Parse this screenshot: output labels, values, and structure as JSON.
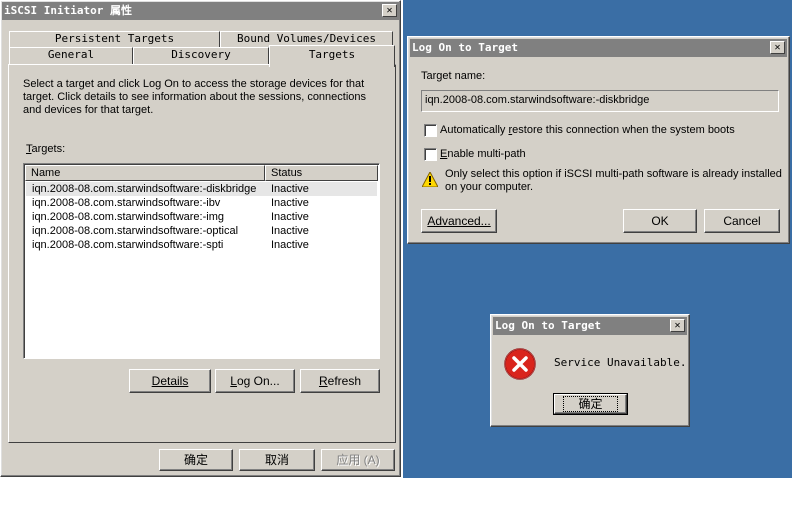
{
  "main_dialog": {
    "title": "iSCSI Initiator 属性",
    "tabs_row1": [
      "Persistent Targets",
      "Bound Volumes/Devices"
    ],
    "tabs_row2": [
      "General",
      "Discovery",
      "Targets"
    ],
    "selected_tab": "Targets",
    "description": "Select a target and click Log On to access the storage devices for that target. Click details to see information about the sessions, connections and devices for that target.",
    "targets_label": "Targets:",
    "columns": [
      "Name",
      "Status"
    ],
    "targets": [
      {
        "name": "iqn.2008-08.com.starwindsoftware:-diskbridge",
        "status": "Inactive"
      },
      {
        "name": "iqn.2008-08.com.starwindsoftware:-ibv",
        "status": "Inactive"
      },
      {
        "name": "iqn.2008-08.com.starwindsoftware:-img",
        "status": "Inactive"
      },
      {
        "name": "iqn.2008-08.com.starwindsoftware:-optical",
        "status": "Inactive"
      },
      {
        "name": "iqn.2008-08.com.starwindsoftware:-spti",
        "status": "Inactive"
      }
    ],
    "details_label": "Details",
    "logon_label": "Log On...",
    "refresh_label": "Refresh",
    "ok_label": "确定",
    "cancel_label": "取消",
    "apply_label": "应用 (A)"
  },
  "logon_dialog": {
    "title": "Log On to Target",
    "target_name_label": "Target name:",
    "target_name_value": "iqn.2008-08.com.starwindsoftware:-diskbridge",
    "auto_restore_label": "Automatically restore this connection when the system boots",
    "auto_restore_checked": false,
    "multipath_label": "Enable multi-path",
    "multipath_checked": false,
    "warning_text": "Only select this option if iSCSI multi-path software is already installed on your computer.",
    "advanced_label": "Advanced...",
    "ok_label": "OK",
    "cancel_label": "Cancel"
  },
  "error_dialog": {
    "title": "Log On to Target",
    "message": "Service Unavailable.",
    "ok_label": "确定"
  },
  "colors": {
    "desktop": "#3a6ea5",
    "dialog_face": "#d4d0c8",
    "error_icon": "#d9241c"
  }
}
